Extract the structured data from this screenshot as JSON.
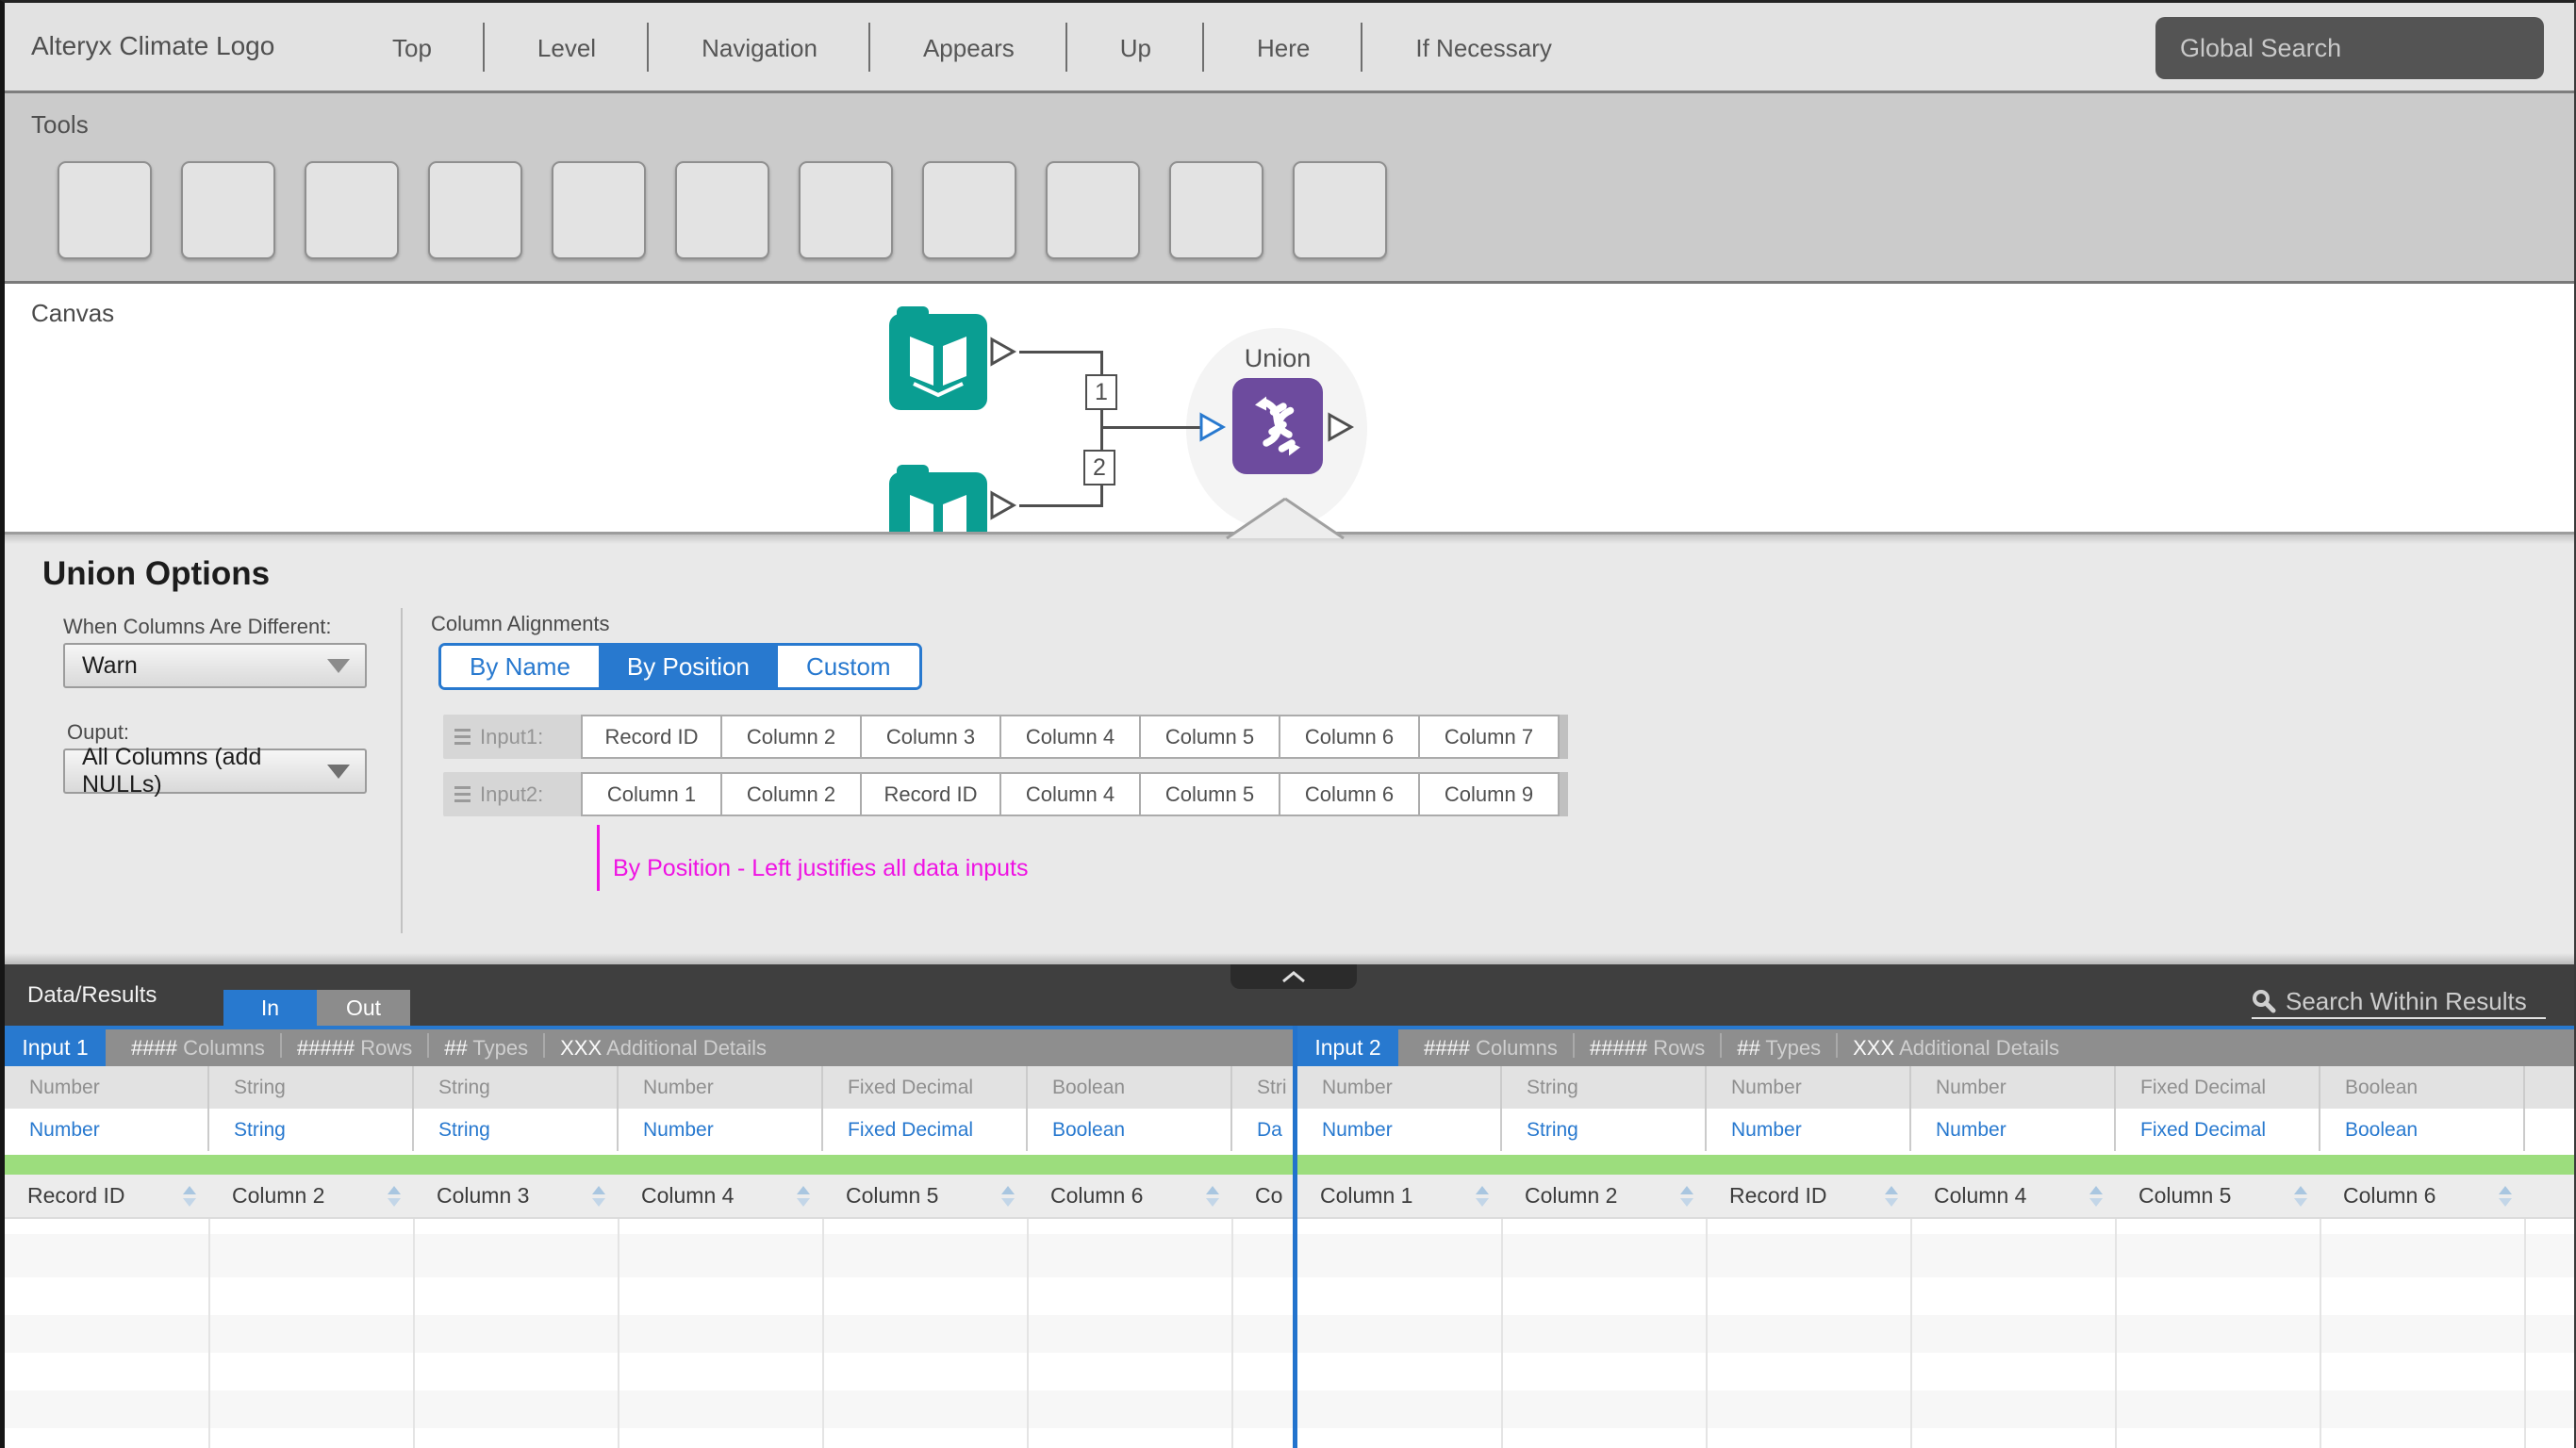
{
  "header": {
    "logo": "Alteryx Climate Logo",
    "menu": [
      "Top",
      "Level",
      "Navigation",
      "Appears",
      "Up",
      "Here",
      "If Necessary"
    ],
    "global_search": "Global Search"
  },
  "toolbar": {
    "title": "Tools",
    "slots": [
      "",
      "",
      "",
      "",
      "",
      "",
      "",
      "",
      "",
      "",
      ""
    ]
  },
  "canvas": {
    "title": "Canvas",
    "connection_labels": [
      "1",
      "2"
    ],
    "tool_name": "Union"
  },
  "options": {
    "title": "Union Options",
    "when_label": "When Columns Are Different:",
    "when_value": "Warn",
    "output_label": "Ouput:",
    "output_value": "All Columns (add NULLs)",
    "alignments_label": "Column Alignments",
    "alignment_tabs": [
      {
        "label": "By Name",
        "active": false
      },
      {
        "label": "By Position",
        "active": true
      },
      {
        "label": "Custom",
        "active": false
      }
    ],
    "input_rows": [
      {
        "label": "Input1:",
        "cells": [
          "Record ID",
          "Column 2",
          "Column 3",
          "Column 4",
          "Column 5",
          "Column 6",
          "Column 7"
        ]
      },
      {
        "label": "Input2:",
        "cells": [
          "Column 1",
          "Column 2",
          "Record ID",
          "Column 4",
          "Column 5",
          "Column 6",
          "Column 9"
        ]
      }
    ],
    "annotation": "By Position - Left justifies all data inputs"
  },
  "results": {
    "title": "Data/Results",
    "toggle": [
      {
        "label": "In",
        "active": true
      },
      {
        "label": "Out",
        "active": false
      }
    ],
    "search_placeholder": "Search Within Results",
    "panels": [
      {
        "tab": "Input 1",
        "meta": [
          {
            "value": "####",
            "label": "Columns"
          },
          {
            "value": "#####",
            "label": "Rows"
          },
          {
            "value": "##",
            "label": "Types"
          },
          {
            "value": "XXX",
            "label": "Additional Details"
          }
        ],
        "type_row_top": [
          "Number",
          "String",
          "String",
          "Number",
          "Fixed Decimal",
          "Boolean",
          "Stri"
        ],
        "type_row_link": [
          "Number",
          "String",
          "String",
          "Number",
          "Fixed Decimal",
          "Boolean",
          "Da"
        ],
        "columns": [
          "Record ID",
          "Column 2",
          "Column 3",
          "Column 4",
          "Column 5",
          "Column 6",
          "Co"
        ]
      },
      {
        "tab": "Input 2",
        "meta": [
          {
            "value": "####",
            "label": "Columns"
          },
          {
            "value": "#####",
            "label": "Rows"
          },
          {
            "value": "##",
            "label": "Types"
          },
          {
            "value": "XXX",
            "label": "Additional Details"
          }
        ],
        "type_row_top": [
          "Number",
          "String",
          "Number",
          "Number",
          "Fixed Decimal",
          "Boolean"
        ],
        "type_row_link": [
          "Number",
          "String",
          "Number",
          "Number",
          "Fixed Decimal",
          "Boolean"
        ],
        "columns": [
          "Column 1",
          "Column 2",
          "Record ID",
          "Column 4",
          "Column 5",
          "Column 6"
        ]
      }
    ]
  },
  "colors": {
    "accent_blue": "#2879cf",
    "teal_tool": "#0a9e92",
    "purple_tool": "#6d4b9e",
    "annotation_magenta": "#ef12e3",
    "selection_green": "#9cdd7d",
    "dark_bar": "#3f3f3f"
  }
}
